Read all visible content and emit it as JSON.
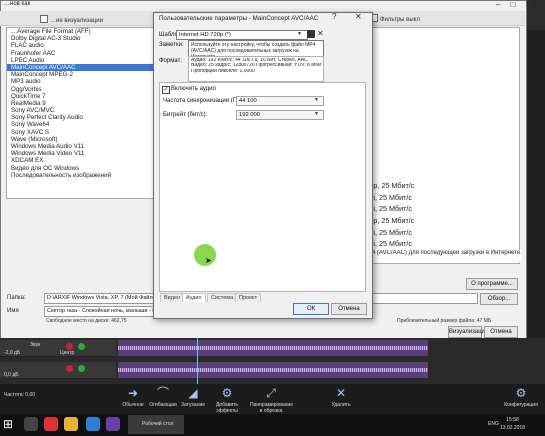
{
  "background": {
    "render_title": "…нов как",
    "toolbar_label": "…ие визуализации",
    "filter_label": "Фильтры выкл",
    "formats": [
      "…Average File Format (AFF)",
      "Dolby Digital AC-3 Studio",
      "FLAC audio",
      "Fraunhofer AAC",
      "LPEC Audio",
      "MainConcept AVC/AAC",
      "MainConcept MPEG-2",
      "MP3 audio",
      "Ogg/Vorbis",
      "QuickTime 7",
      "RealMedia 9",
      "Sony AVC/MVC",
      "Sony Perfect Clarity Audio",
      "Sony Wave64",
      "Sony XAVC S",
      "Wave (Microsoft)",
      "Windows Media Audio V11",
      "Windows Media Video V11",
      "XDCAM EX",
      "Видео для ОС Windows",
      "Последовательность изображений"
    ],
    "selected_format_index": 5,
    "templates": [
      "",
      "",
      "",
      "",
      "",
      "",
      "",
      "",
      "",
      "",
      "",
      "",
      "",
      "-24p, 25 Мбит/с",
      "-50i, 25 Мбит/с",
      "-50i, 25 Мбит/с",
      "-24p, 25 Мбит/с",
      "-50i, 25 Мбит/с",
      "-50i, 25 Мбит/с"
    ],
    "template_desc": "MP4 (AVC/AAC) для последующей загрузки в Интернете.",
    "about_btn": "О программе...",
    "path_label": "Папка:",
    "path_value": "D:\\ARXIF Windows Vista, XP, 7 (Мой Файлы)\\Видео\\Музыка\\",
    "browse_btn": "Обзор...",
    "name_label": "Имя",
    "name_value": "Сектор газа - Спокойная ночь, малыши - By Muzzikant",
    "free_space": "Свободное место на диске: 462,75",
    "est_size": "Приблизительный размер файла: 47 МБ",
    "render_btn": "Визуализация",
    "cancel_btn": "Отмена",
    "track1_name": "Звук",
    "track1_level": "-2,0 дБ",
    "track2_level": "0,0 дБ",
    "center_label": "Центр",
    "rate_label": "Частота: 0,00",
    "toolbar_items": [
      "Обычное",
      "Огибающая",
      "Затухание",
      "Добавить эффекты",
      "Панорамирование и обрезка",
      "Удалить",
      "Конфигурация"
    ],
    "taskbar_app": "Рабочий стол",
    "tray_lang": "ENG",
    "tray_time": "15:58",
    "tray_date": "13.02.2018"
  },
  "dialog": {
    "title": "Пользовательские параметры - MainConcept AVC/AAC",
    "help_icon": "?",
    "close_icon": "✕",
    "template_label": "Шаблон:",
    "template_value": "Internet HD 720p (*)",
    "notes_label": "Заметки:",
    "notes_text": "Используйте эту настройку, чтобы создать файл MP4 (AVC/AAC) для последовательных загрузок на Интернета.",
    "format_label": "Формат:",
    "format_lines": [
      "Аудио: 192 Кбит/с; 44 100 Гц, 16 Бит, Стерео, AAC",
      "Видео: 25 кадр/с; 1280x720 Прогрессивная; YUV; 8 Мбит/с",
      "Пропорции пикселя: 1,0000"
    ],
    "audio_checkbox_label": "Включить аудио",
    "audio_checked": true,
    "sample_rate_label": "Частота синхронизации (Гц):",
    "sample_rate_value": "44 100",
    "bitrate_label": "Битрейт (бит/с):",
    "bitrate_value": "192 000",
    "tabs": [
      "Видео",
      "Аудио",
      "Система",
      "Проект"
    ],
    "active_tab": 1,
    "ok": "ОК",
    "cancel": "Отмена"
  },
  "colors": {
    "selection": "#3979d6",
    "cursor_halo": "#7dd33a",
    "audio_clip": "#5a3e78"
  }
}
